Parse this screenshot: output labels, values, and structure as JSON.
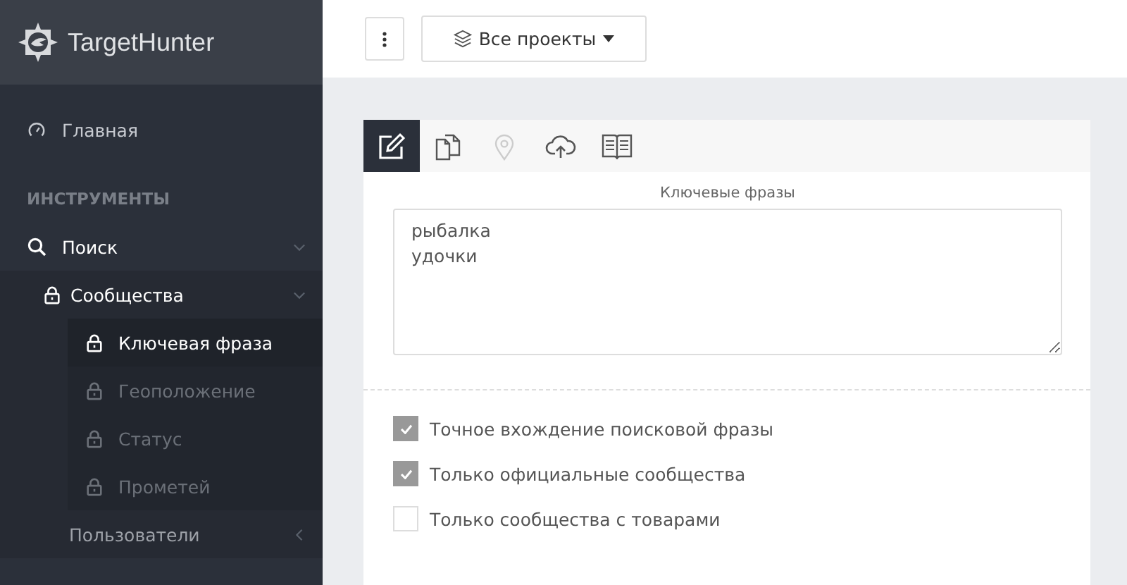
{
  "logo": {
    "text_a": "Target",
    "text_b": "Hunter"
  },
  "sidebar": {
    "items": [
      {
        "kind": "gauge",
        "label": "Главная"
      },
      {
        "kind": "section",
        "label": "ИНСТРУМЕНТЫ"
      },
      {
        "kind": "search",
        "label": "Поиск",
        "expanded": true,
        "children": [
          {
            "kind": "lock",
            "label": "Сообщества",
            "expanded": true,
            "children": [
              {
                "kind": "lock",
                "label": "Ключевая фраза",
                "selected": true,
                "disabled": false
              },
              {
                "kind": "lock",
                "label": "Геоположение",
                "selected": false,
                "disabled": true
              },
              {
                "kind": "lock",
                "label": "Статус",
                "selected": false,
                "disabled": true
              },
              {
                "kind": "lock",
                "label": "Прометей",
                "selected": false,
                "disabled": true
              }
            ]
          },
          {
            "kind": "plain",
            "label": "Пользователи",
            "expanded": false
          }
        ]
      }
    ]
  },
  "topbar": {
    "projects": "Все проекты"
  },
  "tabs": [
    {
      "kind": "edit",
      "selected": true,
      "disabled": false
    },
    {
      "kind": "copy",
      "selected": false,
      "disabled": false
    },
    {
      "kind": "pin",
      "selected": false,
      "disabled": true
    },
    {
      "kind": "upload",
      "selected": false,
      "disabled": false
    },
    {
      "kind": "book",
      "selected": false,
      "disabled": false
    }
  ],
  "form": {
    "phrases_label": "Ключевые фразы",
    "phrases_value": "рыбалка\nудочки",
    "options": [
      {
        "label": "Точное вхождение поисковой фразы",
        "checked": true
      },
      {
        "label": "Только официальные сообщества",
        "checked": true
      },
      {
        "label": "Только сообщества с товарами",
        "checked": false
      }
    ]
  }
}
